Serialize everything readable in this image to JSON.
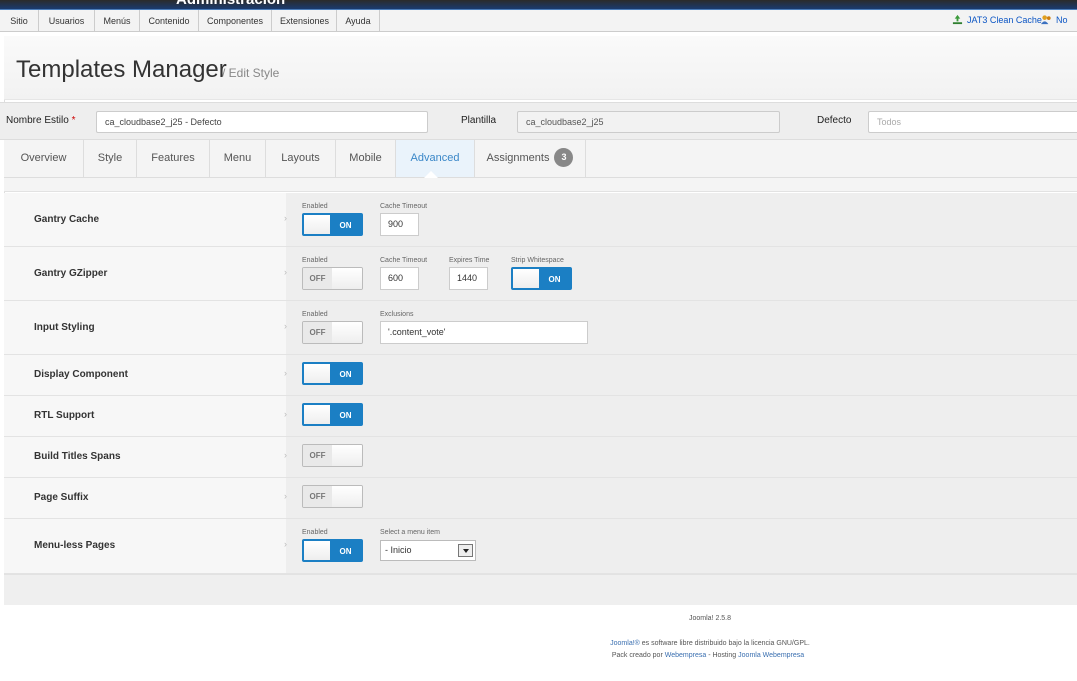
{
  "app": {
    "admin_title": "Administración"
  },
  "menubar": {
    "items": [
      "Sitio",
      "Usuarios",
      "Menús",
      "Contenido",
      "Componentes",
      "Extensiones",
      "Ayuda"
    ],
    "right_items": [
      "JAT3 Clean Cache",
      "No co"
    ]
  },
  "header": {
    "title": "Templates Manager",
    "subtitle": "/ Edit Style"
  },
  "fields": {
    "style_name_label": "Nombre Estilo",
    "style_name_required": "*",
    "style_name_value": "ca_cloudbase2_j25 - Defecto",
    "template_label": "Plantilla",
    "template_value": "ca_cloudbase2_j25",
    "default_label": "Defecto",
    "default_placeholder": "Todos"
  },
  "tabs": {
    "items": [
      "Overview",
      "Style",
      "Features",
      "Menu",
      "Layouts",
      "Mobile",
      "Advanced",
      "Assignments"
    ],
    "active": "Advanced",
    "assignments_count": "3"
  },
  "options": {
    "gantry_cache": {
      "label": "Gantry Cache",
      "enabled_label": "Enabled",
      "enabled": "ON",
      "timeout_label": "Cache Timeout",
      "timeout_value": "900"
    },
    "gantry_gzipper": {
      "label": "Gantry GZipper",
      "enabled_label": "Enabled",
      "enabled": "OFF",
      "timeout_label": "Cache Timeout",
      "timeout_value": "600",
      "expires_label": "Expires Time",
      "expires_value": "1440",
      "strip_label": "Strip Whitespace",
      "strip": "ON"
    },
    "input_styling": {
      "label": "Input Styling",
      "enabled_label": "Enabled",
      "enabled": "OFF",
      "exclusions_label": "Exclusions",
      "exclusions_value": "'.content_vote'"
    },
    "display_component": {
      "label": "Display Component",
      "state": "ON"
    },
    "rtl_support": {
      "label": "RTL Support",
      "state": "ON"
    },
    "build_titles_spans": {
      "label": "Build Titles Spans",
      "state": "OFF"
    },
    "page_suffix": {
      "label": "Page Suffix",
      "state": "OFF"
    },
    "menuless_pages": {
      "label": "Menu-less Pages",
      "enabled_label": "Enabled",
      "enabled": "ON",
      "select_label": "Select a menu item",
      "select_value": "- Inicio"
    }
  },
  "footer": {
    "version": "Joomla! 2.5.8",
    "license_link": "Joomla!®",
    "license_text": " es software libre distribuido bajo la licencia GNU/GPL.",
    "credit_prefix": "Pack creado por ",
    "credit_link1": "Webempresa",
    "credit_mid": " - Hosting ",
    "credit_link2": "Joomla Webempresa"
  },
  "colors": {
    "accent": "#1b7fc4",
    "active_tab": "#3a87c8",
    "required": "#cc0000"
  },
  "icons": [
    "recycle-icon",
    "users-icon",
    "chevron-right-icon",
    "dropdown-arrow-icon"
  ]
}
